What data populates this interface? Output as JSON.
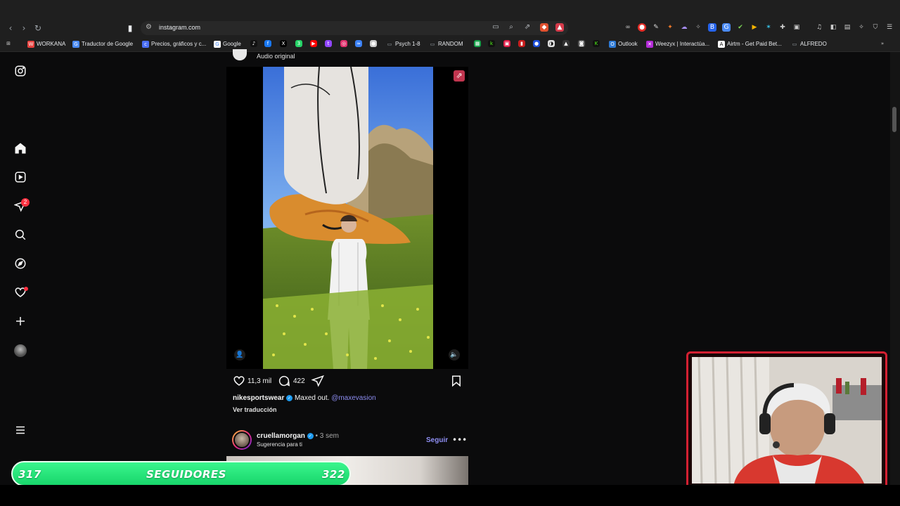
{
  "browser": {
    "url": "instagram.com",
    "bookmarks": [
      {
        "label": "WORKANA",
        "icon": "workana-icon",
        "color": "#e8423f"
      },
      {
        "label": "Traductor de Google",
        "icon": "translate-icon",
        "color": "#4a8af4"
      },
      {
        "label": "Precios, gráficos y c...",
        "icon": "coingecko-icon",
        "color": "#4a6ef5"
      },
      {
        "label": "Google",
        "icon": "google-icon",
        "color": "#ffffff"
      },
      {
        "label": "Psych 1-8",
        "icon": "folder-icon",
        "color": "#9aa0a6"
      },
      {
        "label": "RANDOM",
        "icon": "folder-icon",
        "color": "#9aa0a6"
      },
      {
        "label": "Outlook",
        "icon": "outlook-icon",
        "color": "#2f7bd6"
      },
      {
        "label": "Weezyx | Interactúa...",
        "icon": "weezyx-icon",
        "color": "#b42bd8"
      },
      {
        "label": "Airtm - Get Paid Bet...",
        "icon": "airtm-icon",
        "color": "#ffffff"
      },
      {
        "label": "ALFREDO",
        "icon": "folder-icon",
        "color": "#9aa0a6"
      }
    ]
  },
  "sidebar": {
    "items": [
      {
        "name": "instagram-logo-icon"
      },
      {
        "name": "home-icon"
      },
      {
        "name": "reels-icon"
      },
      {
        "name": "direct-messages-icon",
        "badge": "2"
      },
      {
        "name": "search-icon"
      },
      {
        "name": "explore-icon"
      },
      {
        "name": "notifications-icon"
      },
      {
        "name": "create-icon"
      },
      {
        "name": "profile-avatar"
      }
    ]
  },
  "post": {
    "audio": "Audio original",
    "likes": "11,3 mil",
    "comments": "422",
    "author": "nikesportswear",
    "caption": "Maxed out.",
    "mention": "@maxevasion",
    "translate": "Ver traducción"
  },
  "next_post": {
    "author": "cruellamorgan",
    "time": "• 3 sem",
    "subtitle": "Sugerencia para ti",
    "follow": "Seguir"
  },
  "overlay": {
    "left_count": "317",
    "label": "SEGUIDORES",
    "right_count": "322"
  },
  "colors": {
    "notification": "#ff3040",
    "link": "#8f8ff4",
    "overlay_green": "#18d66b",
    "webcam_border": "#d32032"
  }
}
